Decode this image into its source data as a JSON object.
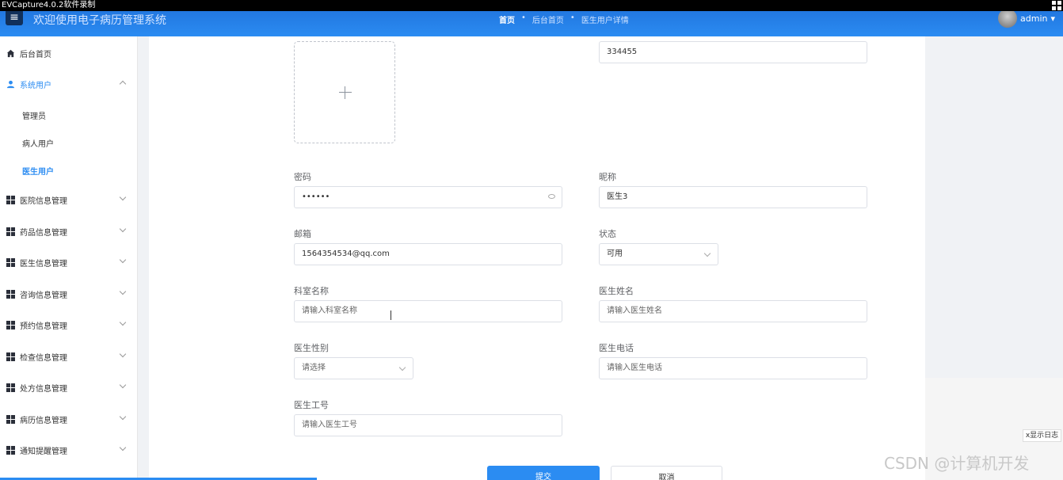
{
  "recorder": {
    "label": "EVCapture4.0.2软件录制"
  },
  "header": {
    "title": "欢迎使用电子病历管理系统",
    "breadcrumbs": [
      "首页",
      "后台首页",
      "医生用户详情"
    ],
    "user": "admin",
    "accent_color": "#2b8cf2"
  },
  "sidebar": {
    "items": [
      {
        "label": "后台首页",
        "icon": "home-icon"
      },
      {
        "label": "系统用户",
        "icon": "user-icon",
        "expanded": true
      },
      {
        "label": "医院信息管理",
        "icon": "grid-icon"
      },
      {
        "label": "药品信息管理",
        "icon": "grid-icon"
      },
      {
        "label": "医生信息管理",
        "icon": "grid-icon"
      },
      {
        "label": "咨询信息管理",
        "icon": "grid-icon"
      },
      {
        "label": "预约信息管理",
        "icon": "grid-icon"
      },
      {
        "label": "检查信息管理",
        "icon": "grid-icon"
      },
      {
        "label": "处方信息管理",
        "icon": "grid-icon"
      },
      {
        "label": "病历信息管理",
        "icon": "grid-icon"
      },
      {
        "label": "通知提醒管理",
        "icon": "grid-icon"
      }
    ],
    "sub_items": [
      {
        "label": "管理员"
      },
      {
        "label": "病人用户"
      },
      {
        "label": "医生用户",
        "active": true
      }
    ]
  },
  "form": {
    "username_value": "334455",
    "password": {
      "label": "密码",
      "value": "••••••"
    },
    "nickname": {
      "label": "昵称",
      "value": "医生3"
    },
    "email": {
      "label": "邮箱",
      "value": "1564354534@qq.com"
    },
    "status": {
      "label": "状态",
      "value": "可用"
    },
    "dept": {
      "label": "科室名称",
      "placeholder": "请输入科室名称"
    },
    "doctor_name": {
      "label": "医生姓名",
      "placeholder": "请输入医生姓名"
    },
    "gender": {
      "label": "医生性别",
      "placeholder": "请选择"
    },
    "phone": {
      "label": "医生电话",
      "placeholder": "请输入医生电话"
    },
    "job_no": {
      "label": "医生工号",
      "placeholder": "请输入医生工号"
    },
    "submit_label": "提交",
    "cancel_label": "取消"
  },
  "overlay": {
    "log_button": "x显示日志",
    "watermark": "CSDN @计算机开发"
  }
}
